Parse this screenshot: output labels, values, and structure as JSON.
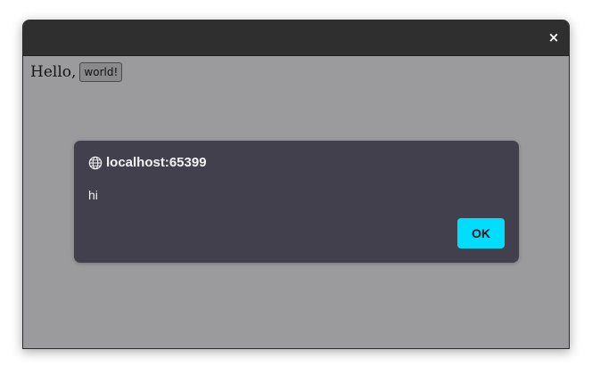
{
  "window": {
    "close_label": "×"
  },
  "page": {
    "greeting_text": "Hello,",
    "button_label": "world!"
  },
  "dialog": {
    "origin": "localhost:65399",
    "message": "hi",
    "ok_label": "OK",
    "origin_icon": "globe-icon"
  },
  "colors": {
    "titlebar": "#2f2f2f",
    "page_overlay": "#9b9a9c",
    "dialog_bg": "#42404c",
    "ok_button": "#00ddff"
  }
}
